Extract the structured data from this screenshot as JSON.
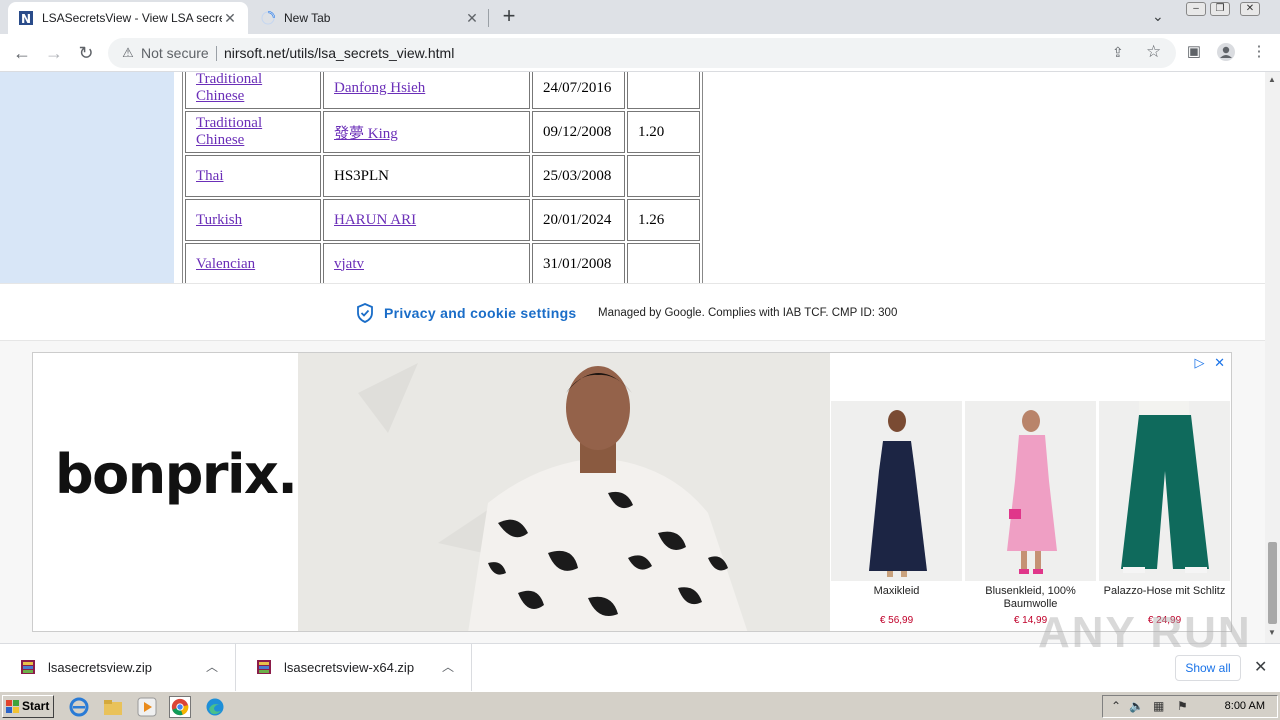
{
  "browser": {
    "tabs": [
      {
        "title": "LSASecretsView - View LSA secrets s",
        "active": true
      },
      {
        "title": "New Tab",
        "active": false
      }
    ],
    "omnibox": {
      "security_label": "Not secure",
      "url": "nirsoft.net/utils/lsa_secrets_view.html"
    }
  },
  "table": {
    "rows": [
      {
        "language": "Traditional Chinese",
        "translator": "Danfong Hsieh",
        "date": "24/07/2016",
        "version": "",
        "translator_link": true
      },
      {
        "language": "Traditional Chinese",
        "translator": "發夢 King",
        "date": "09/12/2008",
        "version": "1.20",
        "translator_link": true
      },
      {
        "language": "Thai",
        "translator": "HS3PLN",
        "date": "25/03/2008",
        "version": "",
        "translator_link": false
      },
      {
        "language": "Turkish",
        "translator": "HARUN ARI",
        "date": "20/01/2024",
        "version": "1.26",
        "translator_link": true
      },
      {
        "language": "Valencian",
        "translator": "vjatv",
        "date": "31/01/2008",
        "version": "",
        "translator_link": true
      }
    ]
  },
  "privacy": {
    "title": "Privacy and cookie settings",
    "description": "Managed by Google. Complies with IAB TCF. CMP ID: 300"
  },
  "ad": {
    "brand": "bonprix.",
    "products": [
      {
        "name": "Maxikleid",
        "price": "€ 56,99"
      },
      {
        "name": "Blusenkleid, 100% Baumwolle",
        "price": "€ 14,99"
      },
      {
        "name": "Palazzo-Hose mit Schlitz",
        "price": "€ 24,99"
      }
    ]
  },
  "downloads": {
    "items": [
      {
        "filename": "lsasecretsview.zip"
      },
      {
        "filename": "lsasecretsview-x64.zip"
      }
    ],
    "show_all_label": "Show all"
  },
  "taskbar": {
    "start_label": "Start",
    "clock": "8:00 AM"
  },
  "watermark": "ANY RUN",
  "colors": {
    "link": "#6b2fb8",
    "privacy_title": "#1a6dc8",
    "price": "#c0002a",
    "left_column": "#d8e6f7"
  }
}
